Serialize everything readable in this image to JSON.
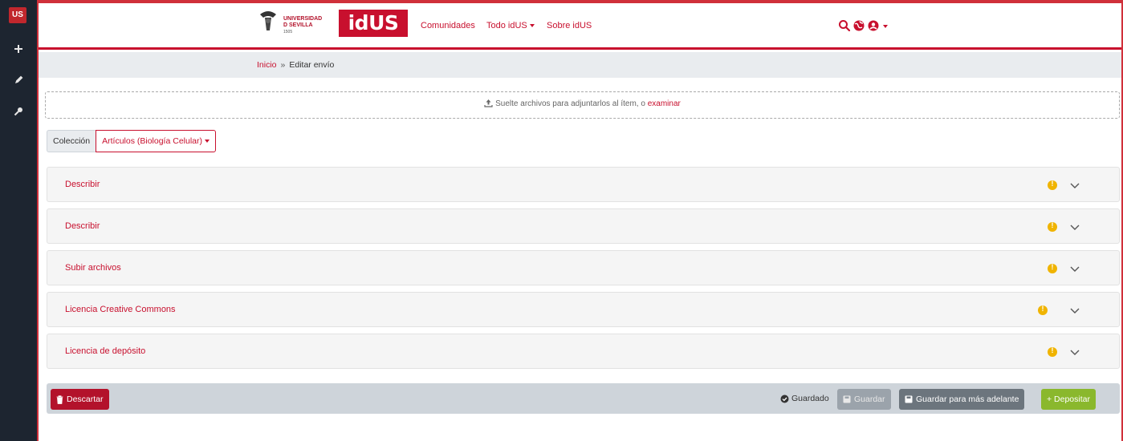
{
  "sidebar": {
    "brand": "US",
    "icons": [
      "plus-icon",
      "pencil-icon",
      "key-icon"
    ]
  },
  "header": {
    "university_lines": [
      "UNIVERSIDAD",
      "D SEVILLA",
      "1505"
    ],
    "app_logo": "idUS",
    "nav": [
      {
        "label": "Comunidades",
        "has_caret": false
      },
      {
        "label": "Todo idUS",
        "has_caret": true
      },
      {
        "label": "Sobre idUS",
        "has_caret": false
      }
    ],
    "icons": [
      "search-icon",
      "globe-icon",
      "user-icon"
    ]
  },
  "breadcrumb": {
    "home": "Inicio",
    "separator": "»",
    "current": "Editar envío"
  },
  "dropzone": {
    "text": "Suelte archivos para adjuntarlos al ítem, o",
    "link": "examinar"
  },
  "collection": {
    "label": "Colección",
    "selected": "Artículos (Biología Celular)"
  },
  "sections": [
    {
      "title": "Describir"
    },
    {
      "title": "Describir"
    },
    {
      "title": "Subir archivos"
    },
    {
      "title": "Licencia Creative Commons"
    },
    {
      "title": "Licencia de depósito"
    }
  ],
  "footer": {
    "discard": "Descartar",
    "status": "Guardado",
    "save": "Guardar",
    "save_later": "Guardar para más adelante",
    "deposit": "+ Depositar"
  },
  "colors": {
    "accent": "#c8102e",
    "sidebar": "#1d2530",
    "warning": "#f0b400",
    "deposit": "#8ab82d"
  }
}
